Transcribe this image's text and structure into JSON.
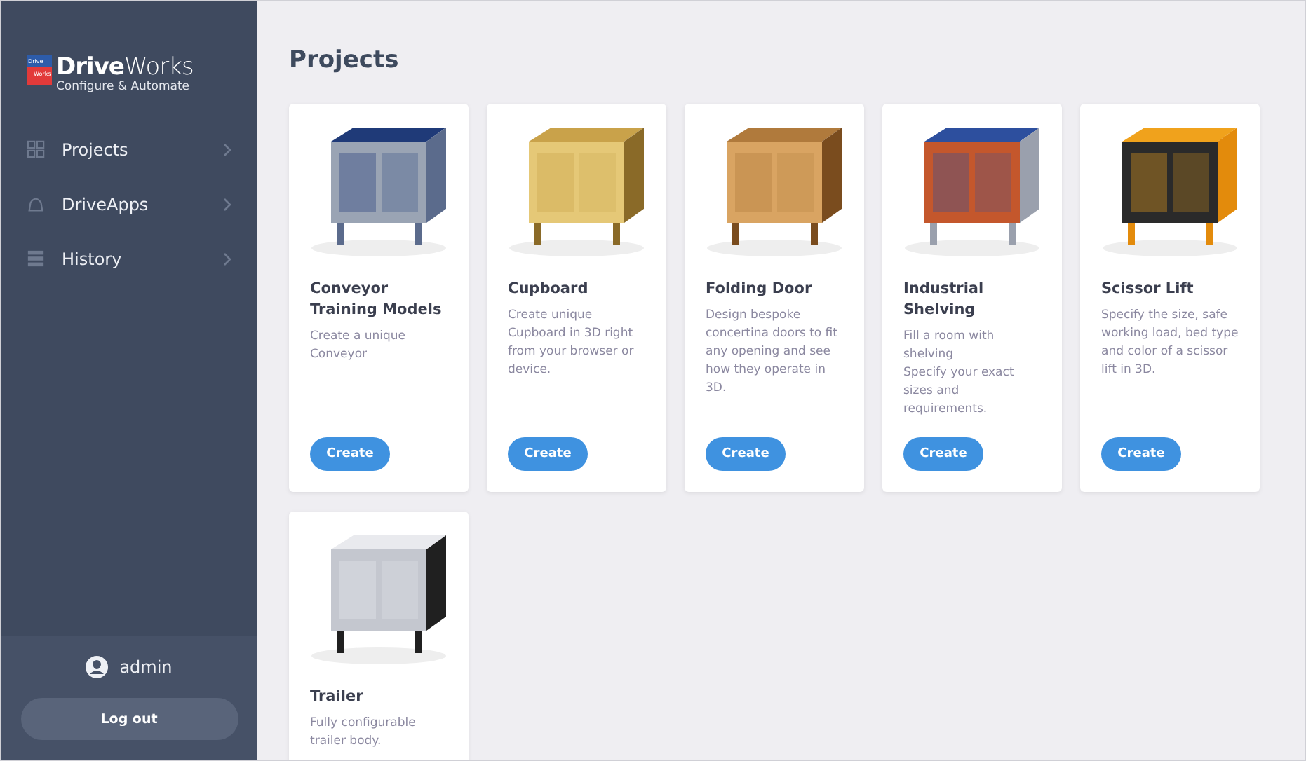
{
  "logo": {
    "badge_top": "Drive",
    "badge_bottom": "Works",
    "name": "**Drive**Works",
    "tagline": "Configure & Automate"
  },
  "sidebar": {
    "items": [
      {
        "label": "Projects",
        "kind": "grid"
      },
      {
        "label": "DriveApps",
        "kind": "bell"
      },
      {
        "label": "History",
        "kind": "list"
      }
    ],
    "user": "admin",
    "logout": "Log out"
  },
  "page_title": "Projects",
  "projects": [
    {
      "title": "Conveyor Training Models",
      "description": "Create a unique Conveyor",
      "button": "Create"
    },
    {
      "title": "Cupboard",
      "description": "Create unique Cupboard in 3D right from your browser or device.",
      "button": "Create"
    },
    {
      "title": "Folding Door",
      "description": "Design bespoke concertina doors to fit any opening and see how they operate in 3D.",
      "button": "Create"
    },
    {
      "title": "Industrial Shelving",
      "description": "Fill a room with shelving\nSpecify your exact sizes and requirements.",
      "button": "Create"
    },
    {
      "title": "Scissor Lift",
      "description": "Specify the size, safe working load, bed type and color of a scissor lift in 3D.",
      "button": "Create"
    },
    {
      "title": "Trailer",
      "description": "Fully configurable trailer body."
    }
  ]
}
